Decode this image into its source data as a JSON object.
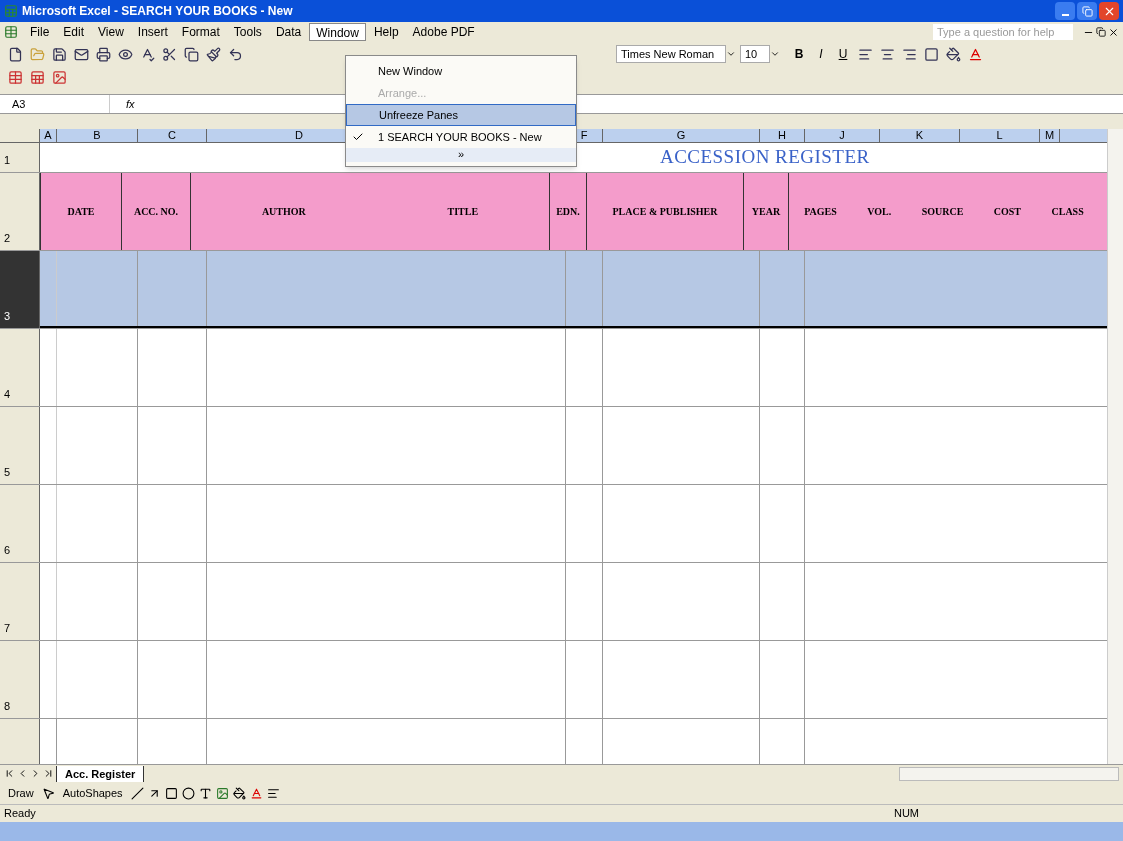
{
  "window": {
    "title": "Microsoft Excel - SEARCH YOUR BOOKS - New"
  },
  "menu_bar": {
    "items": [
      {
        "label": "File",
        "open": false
      },
      {
        "label": "Edit",
        "open": false
      },
      {
        "label": "View",
        "open": false
      },
      {
        "label": "Insert",
        "open": false
      },
      {
        "label": "Format",
        "open": false
      },
      {
        "label": "Tools",
        "open": false
      },
      {
        "label": "Data",
        "open": false
      },
      {
        "label": "Window",
        "open": true
      },
      {
        "label": "Help",
        "open": false
      },
      {
        "label": "Adobe PDF",
        "open": false
      }
    ],
    "help_box": {
      "placeholder": "Type a question for help"
    }
  },
  "window_menu": {
    "items": [
      {
        "kind": "item",
        "label": "New Window",
        "disabled": false,
        "highlighted": false,
        "checked": false
      },
      {
        "kind": "item",
        "label": "Arrange...",
        "disabled": true,
        "highlighted": false,
        "checked": false
      },
      {
        "kind": "item",
        "label": "Unfreeze Panes",
        "disabled": false,
        "highlighted": true,
        "checked": false
      },
      {
        "kind": "item",
        "label": "1 SEARCH YOUR BOOKS - New",
        "disabled": false,
        "highlighted": false,
        "checked": true
      },
      {
        "kind": "more",
        "label": "»"
      }
    ]
  },
  "formatting_toolbar": {
    "font": "Times New Roman",
    "size": "10",
    "bold": "B",
    "italic": "I",
    "underline": "U"
  },
  "formula_bar": {
    "name_box": "A3",
    "fx": "fx"
  },
  "columns": [
    "A",
    "B",
    "C",
    "D",
    "F",
    "G",
    "H",
    "J",
    "K",
    "L",
    "M"
  ],
  "sheet": {
    "title": "ACCESSION REGISTER",
    "header_cells": [
      {
        "texts": [
          "DATE"
        ]
      },
      {
        "texts": [
          "ACC. NO."
        ]
      },
      {
        "texts": [
          "AUTHOR",
          "TITLE"
        ]
      },
      {
        "texts": [
          "EDN."
        ]
      },
      {
        "texts": [
          "PLACE & PUBLISHER"
        ]
      },
      {
        "texts": [
          "YEAR"
        ]
      },
      {
        "texts": [
          "PAGES",
          "VOL.",
          "SOURCE",
          "COST",
          "CLASS"
        ]
      }
    ],
    "rows": [
      {
        "number": "1",
        "selected": false
      },
      {
        "number": "2",
        "selected": false
      },
      {
        "number": "3",
        "selected": true
      },
      {
        "number": "4",
        "selected": false
      },
      {
        "number": "5",
        "selected": false
      },
      {
        "number": "6",
        "selected": false
      },
      {
        "number": "7",
        "selected": false
      },
      {
        "number": "8",
        "selected": false
      }
    ]
  },
  "sheet_tabs": [
    {
      "label": "Acc. Register",
      "selected": true
    }
  ],
  "drawing_toolbar": {
    "draw": "Draw",
    "autoshapes": "AutoShapes"
  },
  "status_bar": {
    "left": "Ready",
    "right": "NUM"
  }
}
